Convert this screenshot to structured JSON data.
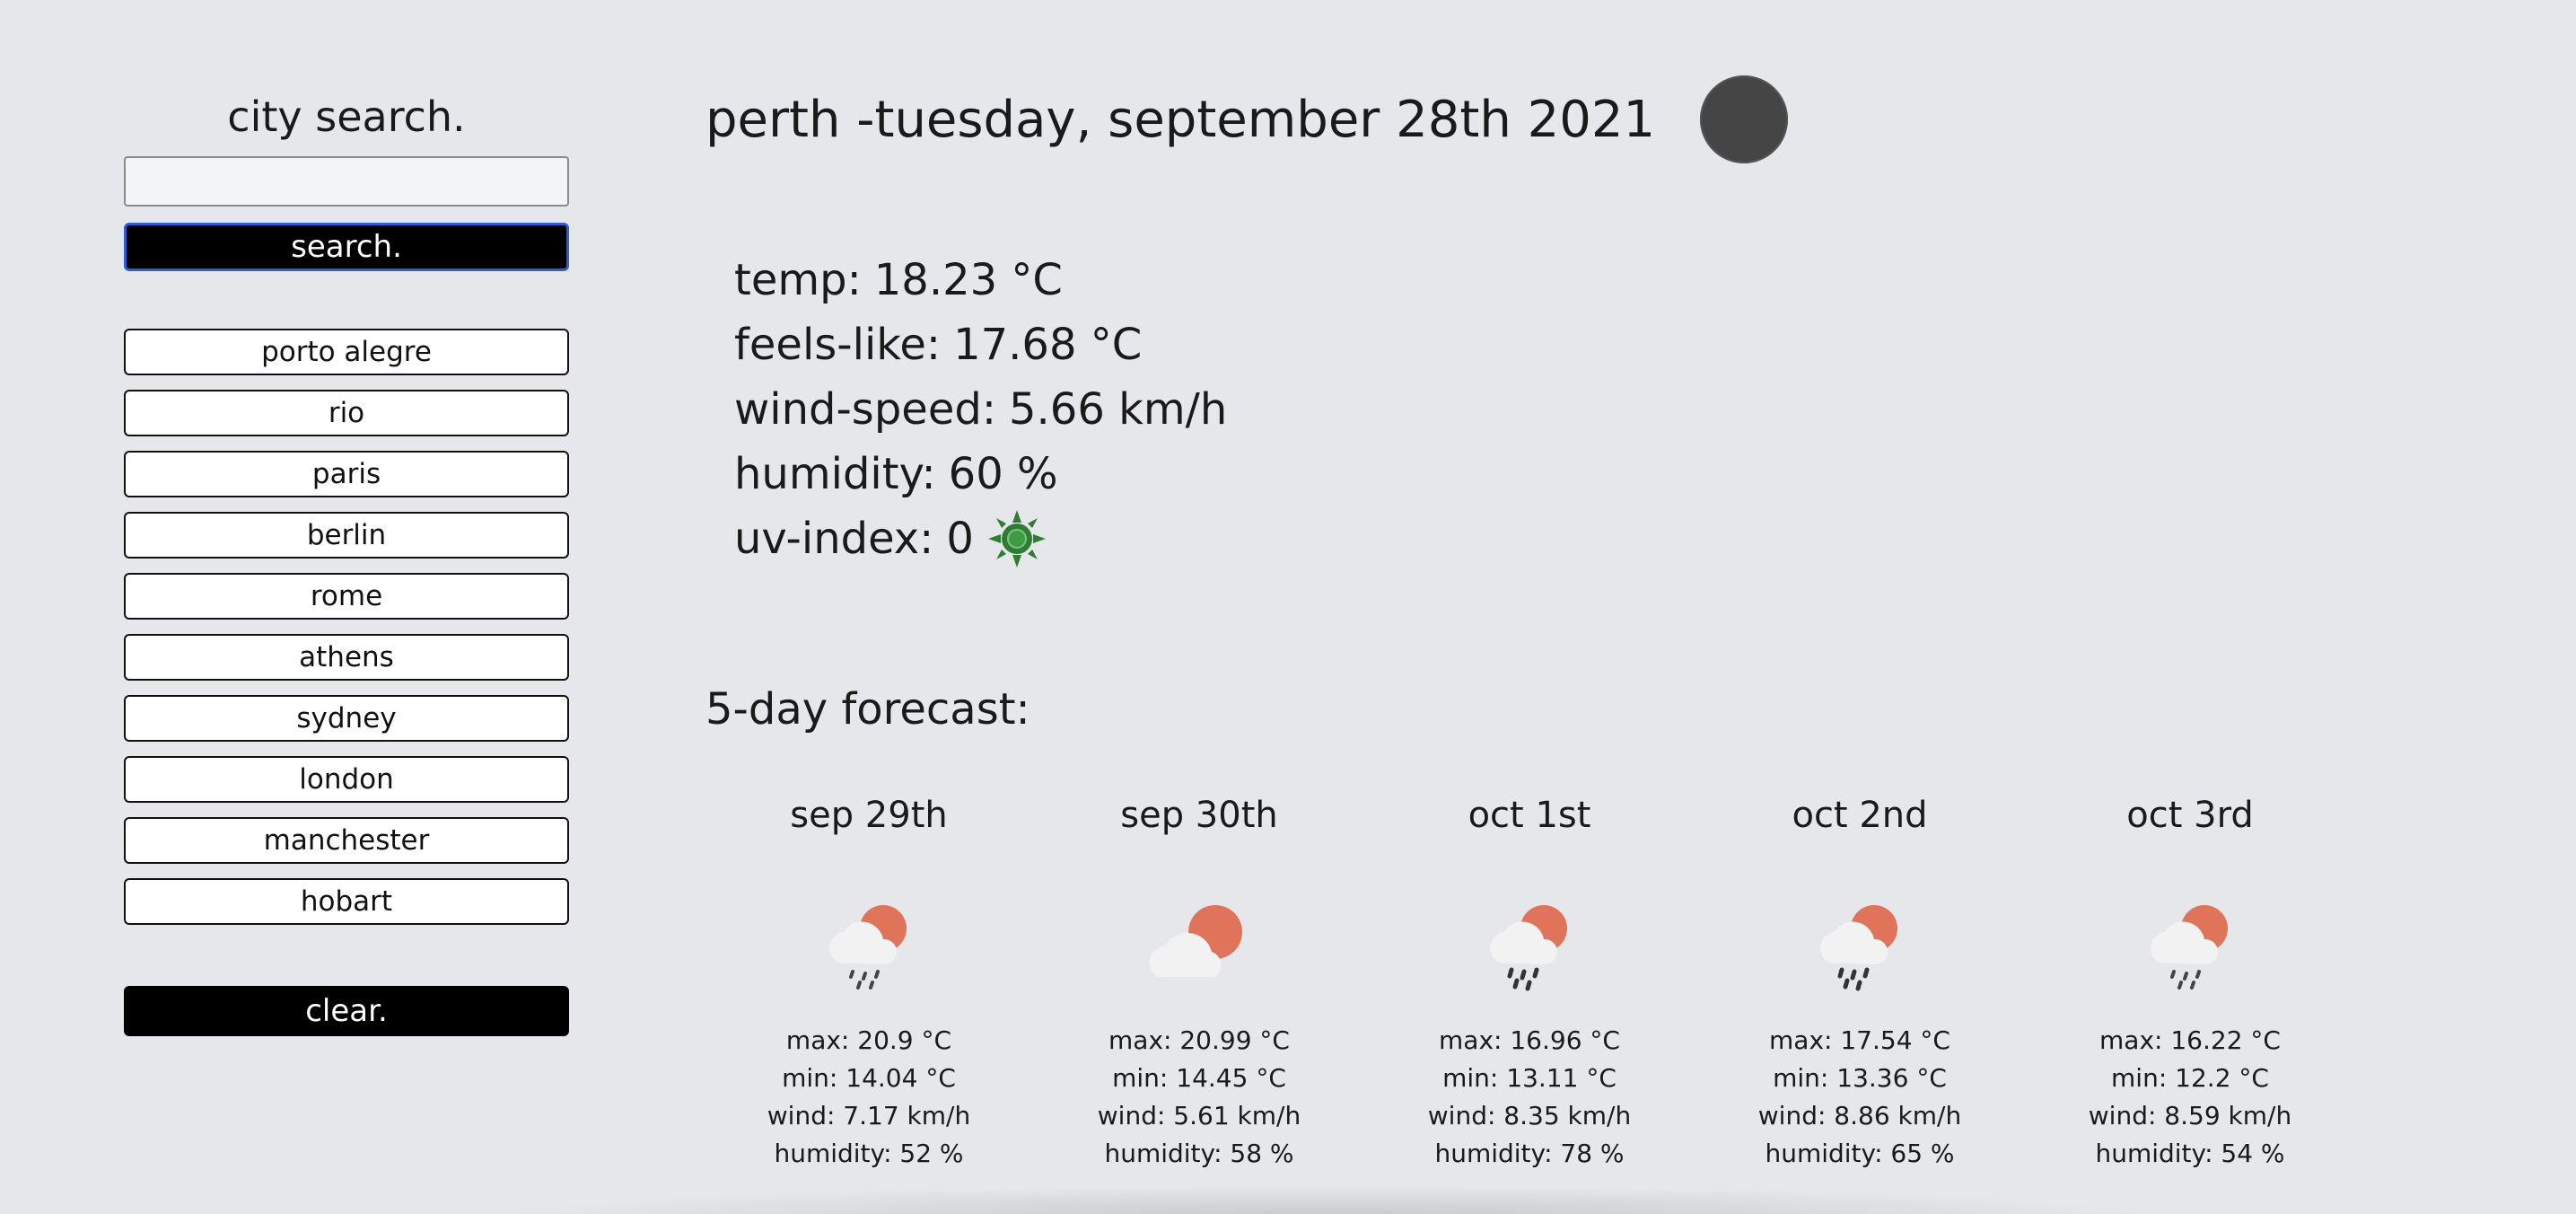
{
  "sidebar": {
    "title": "city search.",
    "search_value": "",
    "search_placeholder": "",
    "search_button_label": "search.",
    "history": [
      "porto alegre",
      "rio",
      "paris",
      "berlin",
      "rome",
      "athens",
      "sydney",
      "london",
      "manchester",
      "hobart"
    ],
    "clear_button_label": "clear."
  },
  "current": {
    "city_date": "perth -tuesday, september 28th 2021",
    "icon": "dark-circle-weather-icon",
    "temp_label": "temp:",
    "temp_value": "18.23 °C",
    "feels_label": "feels-like:",
    "feels_value": "17.68 °C",
    "wind_label": "wind-speed:",
    "wind_value": "5.66 km/h",
    "humidity_label": "humidity:",
    "humidity_value": "60 %",
    "uv_label": "uv-index:",
    "uv_value": "0",
    "uv_icon": "sun-icon",
    "uv_color": "#2e7d32"
  },
  "forecast": {
    "title": "5-day forecast:",
    "days": [
      {
        "date": "sep 29th",
        "icon": "light-rain-icon",
        "max": "max: 20.9 °C",
        "min": "min: 14.04 °C",
        "wind": "wind: 7.17 km/h",
        "humidity": "humidity: 52 %"
      },
      {
        "date": "sep 30th",
        "icon": "partly-cloudy-icon",
        "max": "max: 20.99 °C",
        "min": "min: 14.45 °C",
        "wind": "wind: 5.61 km/h",
        "humidity": "humidity: 58 %"
      },
      {
        "date": "oct 1st",
        "icon": "rain-icon",
        "max": "max: 16.96 °C",
        "min": "min: 13.11 °C",
        "wind": "wind: 8.35 km/h",
        "humidity": "humidity: 78 %"
      },
      {
        "date": "oct 2nd",
        "icon": "rain-icon",
        "max": "max: 17.54 °C",
        "min": "min: 13.36 °C",
        "wind": "wind: 8.86 km/h",
        "humidity": "humidity: 65 %"
      },
      {
        "date": "oct 3rd",
        "icon": "light-rain-icon",
        "max": "max: 16.22 °C",
        "min": "min: 12.2 °C",
        "wind": "wind: 8.59 km/h",
        "humidity": "humidity: 54 %"
      }
    ]
  },
  "colors": {
    "background": "#e5e7eb",
    "button_bg": "#000000",
    "focus_border": "#2f5bd6",
    "sun": "#e0745a",
    "cloud": "#f2f2f2"
  }
}
